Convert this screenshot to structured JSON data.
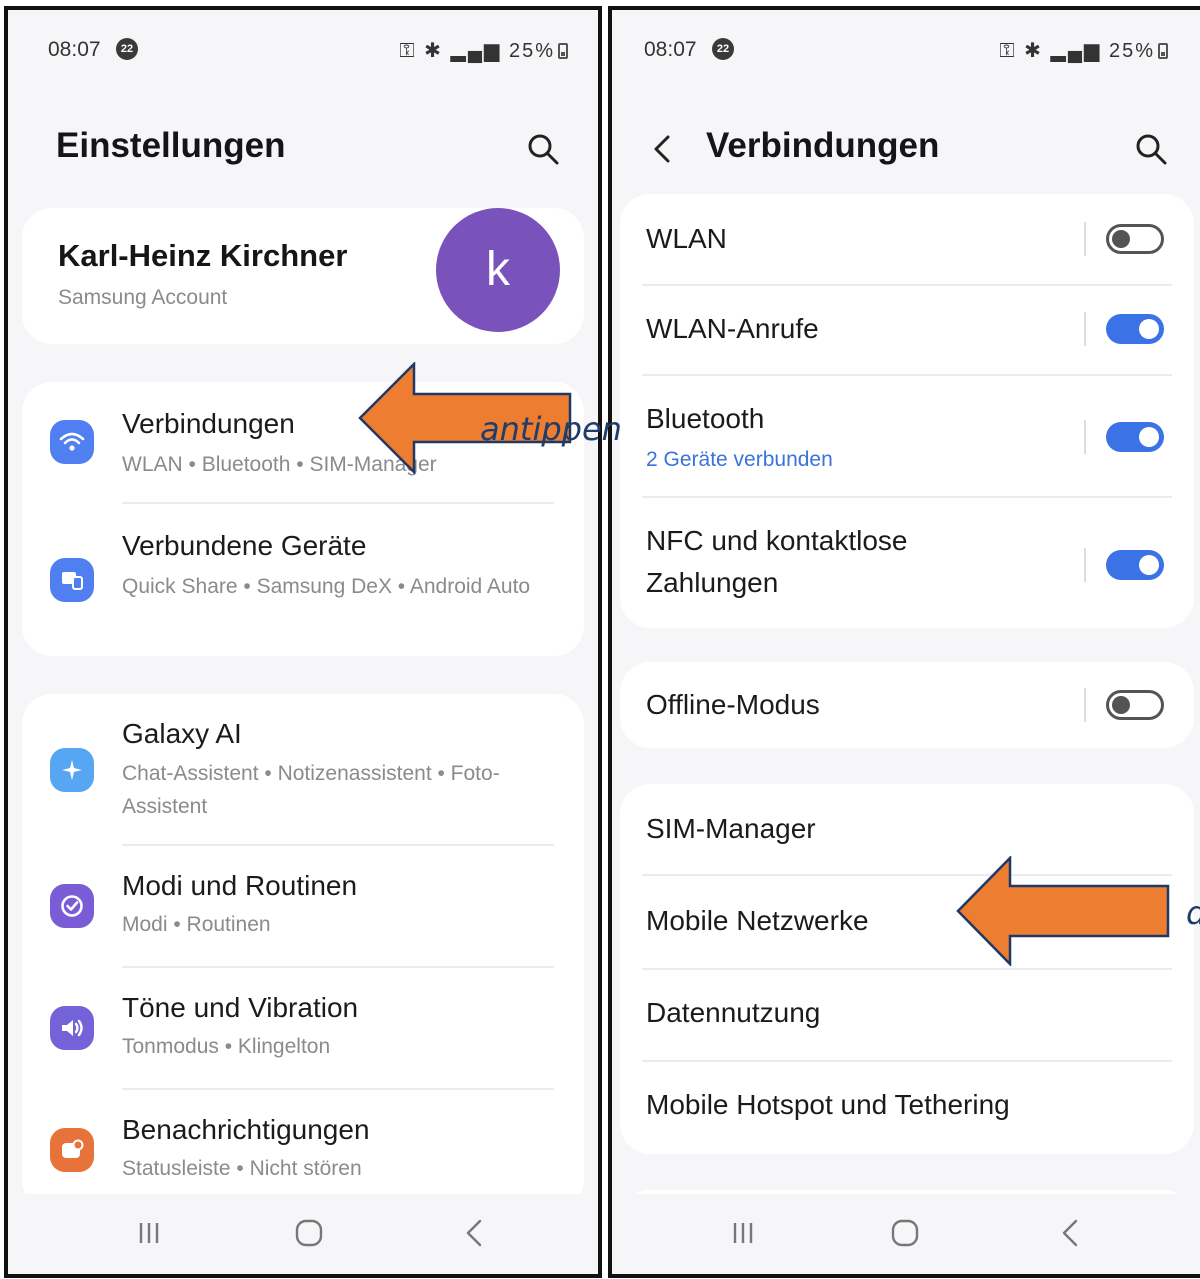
{
  "status_bar": {
    "time": "08:07",
    "notification_count": "22",
    "battery": "25%"
  },
  "left_screen": {
    "title": "Einstellungen",
    "account": {
      "name": "Karl-Heinz Kirchner",
      "subtitle": "Samsung Account",
      "avatar_letter": "k"
    },
    "items": [
      {
        "title": "Verbindungen",
        "subtitle": "WLAN  •  Bluetooth  •  SIM-Manager",
        "icon": "wifi-icon",
        "color": "#4f7ff0"
      },
      {
        "title": "Verbundene Geräte",
        "subtitle": "Quick Share  •  Samsung DeX  •  Android Auto",
        "icon": "devices-icon",
        "color": "#4f7ff0"
      },
      {
        "title": "Galaxy AI",
        "subtitle": "Chat-Assistent  •  Notizenassistent  •  Foto-Assistent",
        "icon": "sparkle-icon",
        "color": "#56a6f3"
      },
      {
        "title": "Modi und Routinen",
        "subtitle": "Modi  •  Routinen",
        "icon": "check-circle-icon",
        "color": "#7a5cd6"
      },
      {
        "title": "Töne und Vibration",
        "subtitle": "Tonmodus  •  Klingelton",
        "icon": "speaker-icon",
        "color": "#7462d9"
      },
      {
        "title": "Benachrichtigungen",
        "subtitle": "Statusleiste  •  Nicht stören",
        "icon": "notification-icon",
        "color": "#e8733a"
      }
    ],
    "annotation": "antippen"
  },
  "right_screen": {
    "title": "Verbindungen",
    "group1": [
      {
        "title": "WLAN",
        "toggle": false
      },
      {
        "title": "WLAN-Anrufe",
        "toggle": true
      },
      {
        "title": "Bluetooth",
        "subtitle": "2 Geräte verbunden",
        "toggle": true
      },
      {
        "title": "NFC und kontaktlose Zahlungen",
        "toggle": true
      }
    ],
    "group2": [
      {
        "title": "Offline-Modus",
        "toggle": false
      }
    ],
    "group3": [
      {
        "title": "SIM-Manager"
      },
      {
        "title": "Mobile Netzwerke"
      },
      {
        "title": "Datennutzung"
      },
      {
        "title": "Mobile Hotspot und Tethering"
      }
    ],
    "annotation_partial": "d"
  },
  "colors": {
    "arrow_fill": "#ed7d31",
    "arrow_stroke": "#1f3864",
    "toggle_on": "#3b73e6",
    "link_blue": "#3a73d9"
  }
}
